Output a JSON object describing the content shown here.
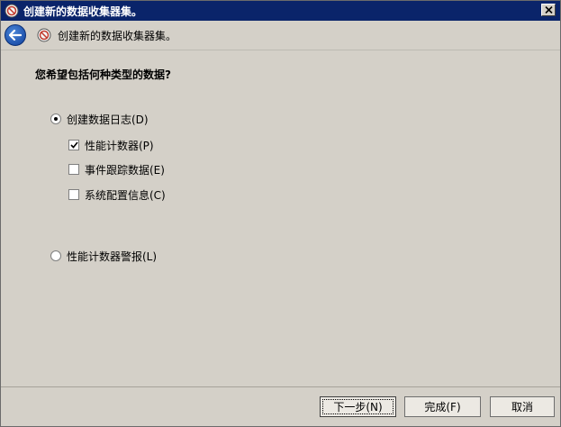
{
  "window": {
    "title": "创建新的数据收集器集。"
  },
  "nav": {
    "title": "创建新的数据收集器集。"
  },
  "main": {
    "question": "您希望包括何种类型的数据?",
    "options": {
      "create_logs": {
        "label": "创建数据日志(D)",
        "selected": true
      },
      "perf_counter": {
        "label": "性能计数器(P)",
        "checked": true
      },
      "event_trace": {
        "label": "事件跟踪数据(E)",
        "checked": false
      },
      "system_config": {
        "label": "系统配置信息(C)",
        "checked": false
      },
      "perf_alert": {
        "label": "性能计数器警报(L)",
        "selected": false
      }
    }
  },
  "footer": {
    "next_label": "下一步(N)",
    "finish_label": "完成(F)",
    "cancel_label": "取消"
  },
  "icons": {
    "app": "data-collector-icon",
    "close": "close-icon",
    "back": "back-arrow-icon"
  },
  "colors": {
    "titlebar": "#0a246a",
    "background": "#d4d0c8"
  }
}
